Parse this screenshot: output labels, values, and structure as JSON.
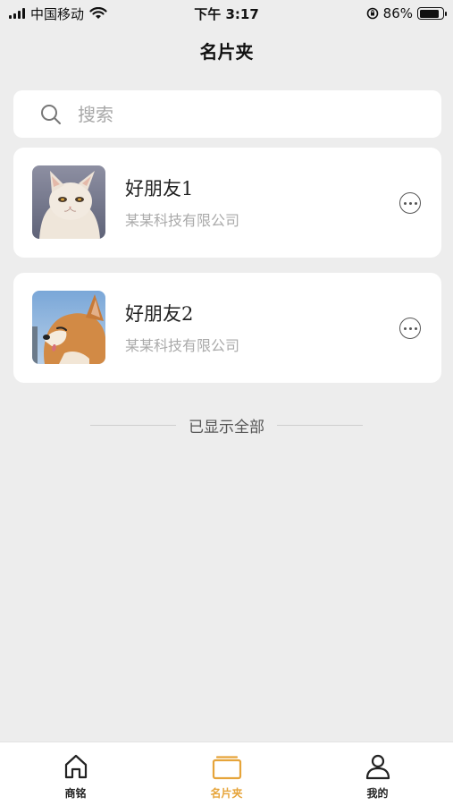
{
  "status_bar": {
    "carrier": "中国移动",
    "time": "下午 3:17",
    "battery_percent": "86%",
    "battery_level": 0.86
  },
  "header": {
    "title": "名片夹"
  },
  "search": {
    "placeholder": "搜索"
  },
  "contacts": [
    {
      "name": "好朋友1",
      "company": "某某科技有限公司",
      "avatar": "cat-photo"
    },
    {
      "name": "好朋友2",
      "company": "某某科技有限公司",
      "avatar": "shiba-dog-photo"
    }
  ],
  "list_end_text": "已显示全部",
  "tab_bar": {
    "tabs": [
      {
        "label": "商铭",
        "icon": "home-icon",
        "active": false
      },
      {
        "label": "名片夹",
        "icon": "card-folder-icon",
        "active": true
      },
      {
        "label": "我的",
        "icon": "user-icon",
        "active": false
      }
    ]
  },
  "colors": {
    "accent": "#e6a43a",
    "background": "#ededed"
  }
}
